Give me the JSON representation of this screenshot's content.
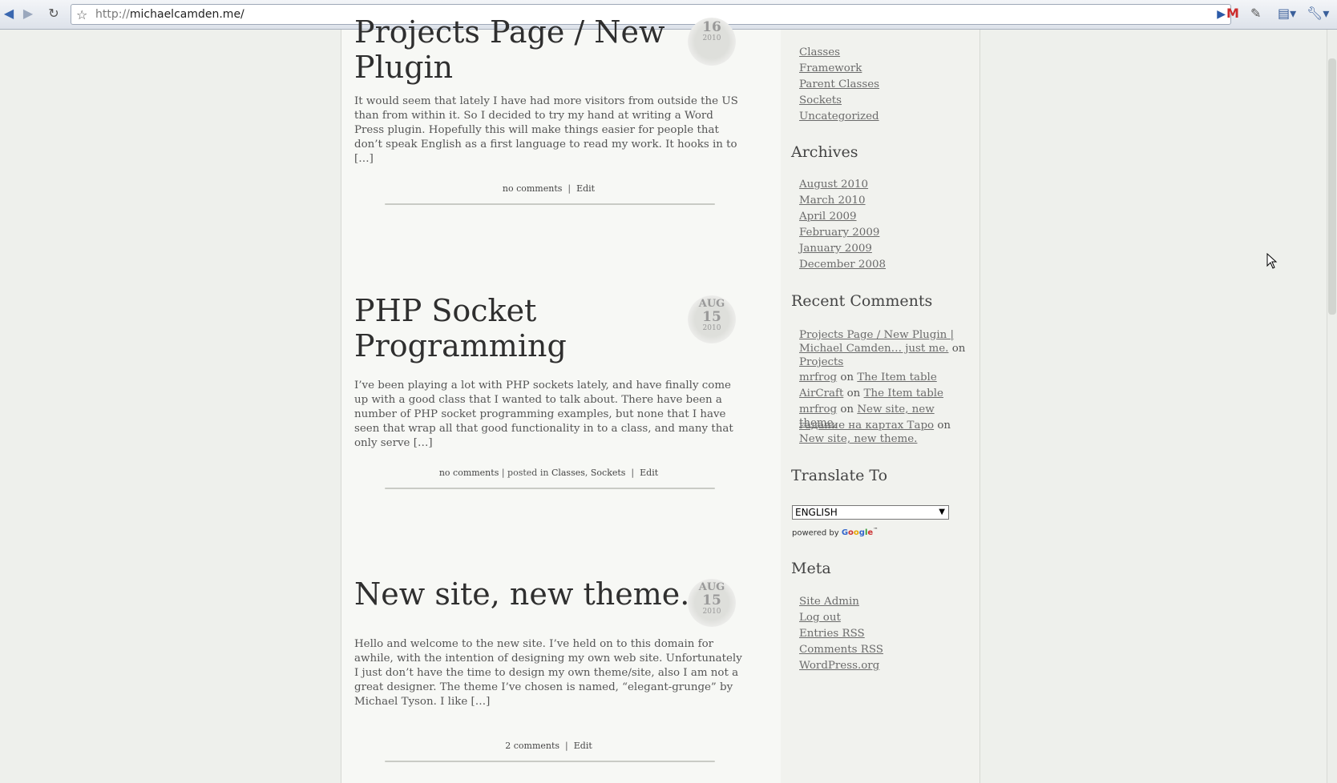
{
  "browser": {
    "url_proto": "http://",
    "url_host": "michaelcamden.me/"
  },
  "posts": [
    {
      "title_line1": "Projects Page / New",
      "title_line2": "Plugin",
      "date": {
        "month": "",
        "day": "16",
        "year": "2010"
      },
      "excerpt": "It would seem that lately I have had more visitors from outside the US than from within it. So I decided to try my hand at writing a Word Press plugin. Hopefully this will make things easier for people that don’t speak English as a first language to read my work. It hooks in to […]",
      "comments": "no comments",
      "posted_in": "",
      "edit": "Edit"
    },
    {
      "title_line1": "PHP Socket",
      "title_line2": "Programming",
      "date": {
        "month": "AUG",
        "day": "15",
        "year": "2010"
      },
      "excerpt": "I’ve been playing a lot with PHP sockets lately, and have finally come up with a good class that I wanted to talk about. There have been a number of PHP socket programming examples, but none that I have seen that wrap all that good functionality in to a class, and many that only serve […]",
      "comments": "no comments",
      "posted_in_label": "| posted in",
      "categories": [
        "Classes",
        "Sockets"
      ],
      "edit": "Edit"
    },
    {
      "title_line1": "New site, new theme.",
      "date": {
        "month": "AUG",
        "day": "15",
        "year": "2010"
      },
      "excerpt": "Hello and welcome to the new site. I’ve held on to this domain for awhile, with the intention of designing my own web site. Unfortunately I just don’t have the time to design my own theme/site, also I am not a great designer. The theme I’ve chosen is named, “elegant-grunge” by Michael Tyson. I like […]",
      "comments": "2 comments",
      "edit": "Edit"
    }
  ],
  "sidebar": {
    "categories": [
      "Classes",
      "Framework",
      "Parent Classes",
      "Sockets",
      "Uncategorized"
    ],
    "archives_title": "Archives",
    "archives": [
      "August 2010",
      "March 2010",
      "April 2009",
      "February 2009",
      "January 2009",
      "December 2008"
    ],
    "recent_comments_title": "Recent Comments",
    "recent_comments": [
      {
        "author": "Projects Page / New Plugin | Michael Camden… just me.",
        "on": "on",
        "post": "Projects"
      },
      {
        "author": "mrfrog",
        "on": "on",
        "post": "The Item table"
      },
      {
        "author": "AirCraft",
        "on": "on",
        "post": "The Item table"
      },
      {
        "author": "mrfrog",
        "on": "on",
        "post": "New site, new theme."
      },
      {
        "author": "гадание на картах Таро",
        "on": "on",
        "post": "New site, new theme."
      }
    ],
    "translate_title": "Translate To",
    "translate_selected": "ENGLISH",
    "powered_by": "powered by",
    "meta_title": "Meta",
    "meta": [
      "Site Admin",
      "Log out",
      "Entries RSS",
      "Comments RSS",
      "WordPress.org"
    ]
  },
  "icons": {
    "back": "back-arrow-icon",
    "forward": "forward-arrow-icon",
    "reload": "reload-icon",
    "bookmark": "star-icon",
    "go": "go-arrow-icon",
    "gmail": "gmail-icon",
    "eyedropper": "eyedropper-icon",
    "page_menu": "page-menu-icon",
    "wrench_menu": "wrench-menu-icon"
  }
}
